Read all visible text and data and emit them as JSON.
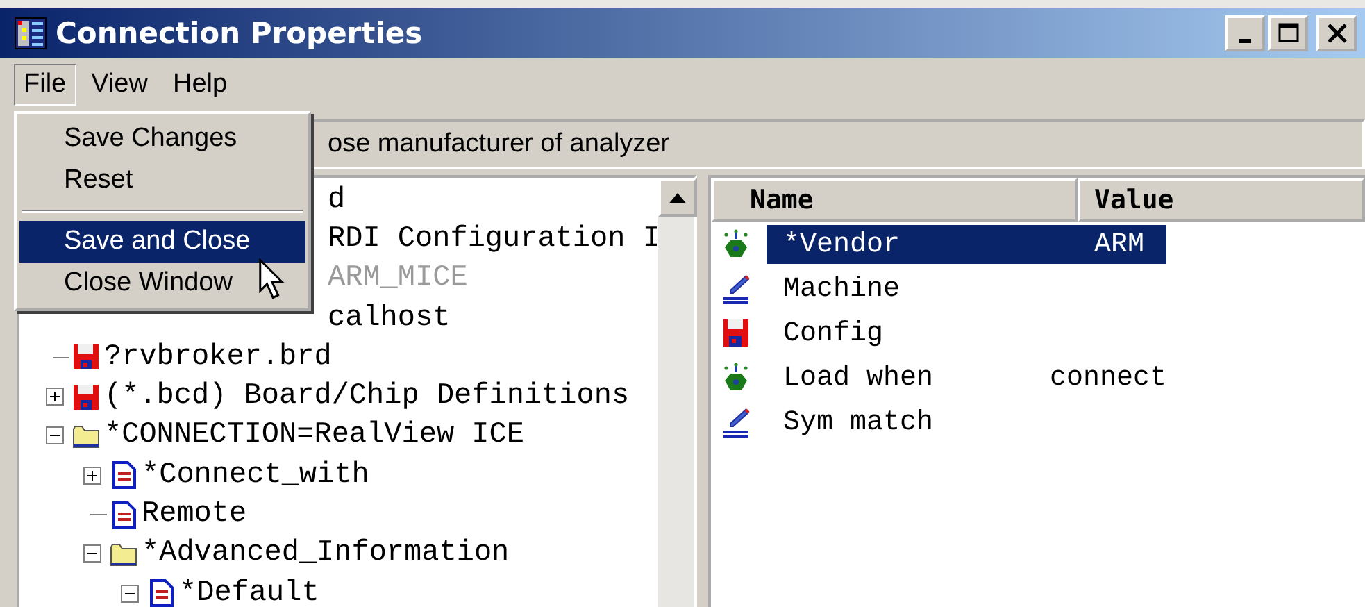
{
  "window": {
    "title": "Connection Properties"
  },
  "menu_bar": [
    {
      "label": "File",
      "selected": true
    },
    {
      "label": "View",
      "selected": false
    },
    {
      "label": "Help",
      "selected": false
    }
  ],
  "file_menu": [
    {
      "kind": "item",
      "label": "Save Changes",
      "selected": false
    },
    {
      "kind": "item",
      "label": "Reset",
      "selected": false
    },
    {
      "kind": "separator"
    },
    {
      "kind": "item",
      "label": "Save and Close",
      "selected": true
    },
    {
      "kind": "item",
      "label": "Close Window",
      "selected": false
    }
  ],
  "description": "ose manufacturer of analyzer",
  "tree": [
    {
      "kind": "clipped",
      "text": "d",
      "disabled": false
    },
    {
      "kind": "clipped",
      "text": "RDI Configuration I",
      "disabled": false
    },
    {
      "kind": "clipped",
      "text": "ARM_MICE",
      "disabled": true
    },
    {
      "kind": "clipped",
      "text": "calhost",
      "disabled": false
    },
    {
      "kind": "disk",
      "text": "?rvbroker.brd"
    },
    {
      "kind": "disk",
      "text": "(*.bcd) Board/Chip Definitions",
      "expanded": false
    },
    {
      "kind": "folder",
      "text": "*CONNECTION=RealView ICE",
      "expanded": true,
      "children": [
        {
          "kind": "doc",
          "text": "*Connect_with",
          "expanded": false
        },
        {
          "kind": "doc",
          "text": "Remote"
        },
        {
          "kind": "folder",
          "text": "*Advanced_Information",
          "expanded": true,
          "children": [
            {
              "kind": "doc",
              "text": "*Default",
              "expanded": true
            }
          ]
        }
      ]
    }
  ],
  "list": {
    "columns": [
      "Name",
      "Value"
    ],
    "rows": [
      {
        "kind": "beacon",
        "name": "*Vendor",
        "value": "ARM",
        "selected": true
      },
      {
        "kind": "pen",
        "name": "Machine",
        "selected": false
      },
      {
        "kind": "disk",
        "name": "Config",
        "selected": false
      },
      {
        "kind": "beacon",
        "name": "Load when",
        "value": "connect",
        "selected": false
      },
      {
        "kind": "pen",
        "name": "Sym match",
        "selected": false
      }
    ]
  }
}
